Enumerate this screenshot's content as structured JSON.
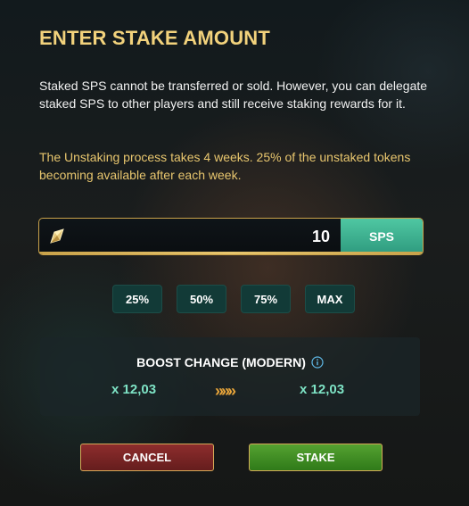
{
  "dialog": {
    "title": "ENTER STAKE AMOUNT",
    "description": "Staked SPS cannot be transferred or sold. However, you can delegate staked SPS to other players and still receive staking rewards for it.",
    "unstaking_note": "The Unstaking process takes 4 weeks. 25% of the unstaked tokens becoming available after each week."
  },
  "amount": {
    "value": "10",
    "unit": "SPS",
    "icon": "sps-token-icon"
  },
  "percent_buttons": [
    "25%",
    "50%",
    "75%",
    "MAX"
  ],
  "boost": {
    "title": "BOOST CHANGE (MODERN)",
    "current": "x 12,03",
    "new": "x 12,03",
    "arrow": "»»»",
    "info_icon": "info-icon"
  },
  "actions": {
    "cancel": "CANCEL",
    "stake": "STAKE"
  },
  "colors": {
    "title": "#f2d27c",
    "note": "#e8c66e",
    "boost_value": "#7ee3c5",
    "accent_gold": "#c9a24a",
    "unit_teal": "#3bb190",
    "cancel": "#8e2d2d",
    "stake": "#4a9a2a"
  }
}
